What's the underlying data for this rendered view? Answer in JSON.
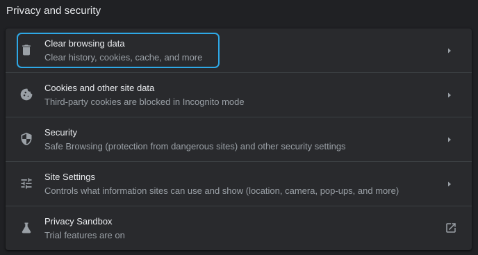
{
  "section": {
    "title": "Privacy and security"
  },
  "rows": [
    {
      "icon": "trash-icon",
      "title": "Clear browsing data",
      "subtitle": "Clear history, cookies, cache, and more",
      "action": "arrow-right-icon"
    },
    {
      "icon": "cookie-icon",
      "title": "Cookies and other site data",
      "subtitle": "Third-party cookies are blocked in Incognito mode",
      "action": "arrow-right-icon"
    },
    {
      "icon": "shield-icon",
      "title": "Security",
      "subtitle": "Safe Browsing (protection from dangerous sites) and other security settings",
      "action": "arrow-right-icon"
    },
    {
      "icon": "tune-icon",
      "title": "Site Settings",
      "subtitle": "Controls what information sites can use and show (location, camera, pop-ups, and more)",
      "action": "arrow-right-icon"
    },
    {
      "icon": "flask-icon",
      "title": "Privacy Sandbox",
      "subtitle": "Trial features are on",
      "action": "open-in-new-icon"
    }
  ],
  "colors": {
    "background": "#202124",
    "card": "#292a2d",
    "focus_ring": "#2ea8e6",
    "primary_text": "#e8eaed",
    "secondary_text": "#9aa0a6"
  }
}
